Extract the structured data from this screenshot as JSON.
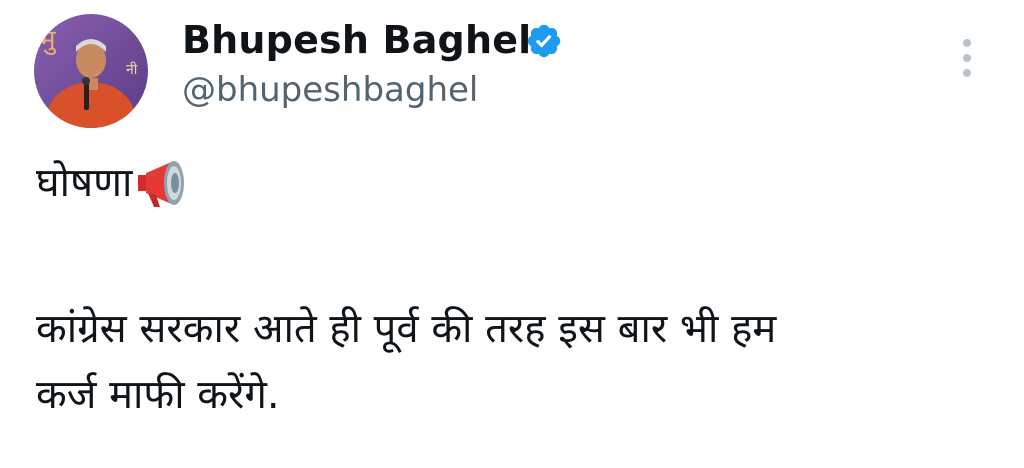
{
  "author": {
    "display_name": "Bhupesh Baghel",
    "handle": "@bhupeshbaghel",
    "verified": true,
    "avatar_icon": "profile-photo"
  },
  "tweet": {
    "heading": "घोषणा",
    "heading_emoji": "megaphone-icon",
    "body_lines": [
      "कांग्रेस सरकार आते ही पूर्व की तरह इस बार भी हम",
      "कर्ज माफी करेंगे."
    ]
  },
  "colors": {
    "verified_blue": "#1d9bf0",
    "secondary_text": "#536471",
    "more_dots": "#b8c2cc"
  }
}
